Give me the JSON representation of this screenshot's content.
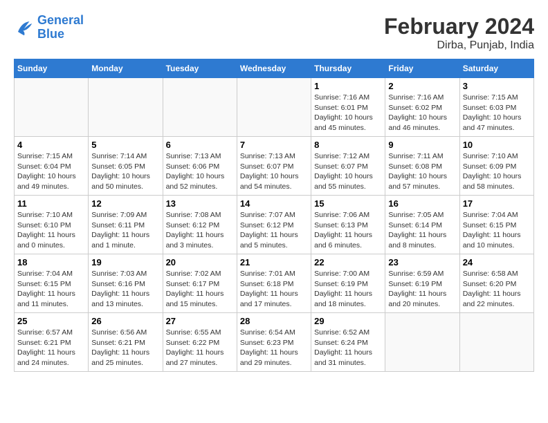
{
  "header": {
    "logo_line1": "General",
    "logo_line2": "Blue",
    "title": "February 2024",
    "subtitle": "Dirba, Punjab, India"
  },
  "days_of_week": [
    "Sunday",
    "Monday",
    "Tuesday",
    "Wednesday",
    "Thursday",
    "Friday",
    "Saturday"
  ],
  "weeks": [
    {
      "days": [
        {
          "number": "",
          "empty": true
        },
        {
          "number": "",
          "empty": true
        },
        {
          "number": "",
          "empty": true
        },
        {
          "number": "",
          "empty": true
        },
        {
          "number": "1",
          "sunrise": "7:16 AM",
          "sunset": "6:01 PM",
          "daylight": "10 hours and 45 minutes."
        },
        {
          "number": "2",
          "sunrise": "7:16 AM",
          "sunset": "6:02 PM",
          "daylight": "10 hours and 46 minutes."
        },
        {
          "number": "3",
          "sunrise": "7:15 AM",
          "sunset": "6:03 PM",
          "daylight": "10 hours and 47 minutes."
        }
      ]
    },
    {
      "days": [
        {
          "number": "4",
          "sunrise": "7:15 AM",
          "sunset": "6:04 PM",
          "daylight": "10 hours and 49 minutes."
        },
        {
          "number": "5",
          "sunrise": "7:14 AM",
          "sunset": "6:05 PM",
          "daylight": "10 hours and 50 minutes."
        },
        {
          "number": "6",
          "sunrise": "7:13 AM",
          "sunset": "6:06 PM",
          "daylight": "10 hours and 52 minutes."
        },
        {
          "number": "7",
          "sunrise": "7:13 AM",
          "sunset": "6:07 PM",
          "daylight": "10 hours and 54 minutes."
        },
        {
          "number": "8",
          "sunrise": "7:12 AM",
          "sunset": "6:07 PM",
          "daylight": "10 hours and 55 minutes."
        },
        {
          "number": "9",
          "sunrise": "7:11 AM",
          "sunset": "6:08 PM",
          "daylight": "10 hours and 57 minutes."
        },
        {
          "number": "10",
          "sunrise": "7:10 AM",
          "sunset": "6:09 PM",
          "daylight": "10 hours and 58 minutes."
        }
      ]
    },
    {
      "days": [
        {
          "number": "11",
          "sunrise": "7:10 AM",
          "sunset": "6:10 PM",
          "daylight": "11 hours and 0 minutes."
        },
        {
          "number": "12",
          "sunrise": "7:09 AM",
          "sunset": "6:11 PM",
          "daylight": "11 hours and 1 minute."
        },
        {
          "number": "13",
          "sunrise": "7:08 AM",
          "sunset": "6:12 PM",
          "daylight": "11 hours and 3 minutes."
        },
        {
          "number": "14",
          "sunrise": "7:07 AM",
          "sunset": "6:12 PM",
          "daylight": "11 hours and 5 minutes."
        },
        {
          "number": "15",
          "sunrise": "7:06 AM",
          "sunset": "6:13 PM",
          "daylight": "11 hours and 6 minutes."
        },
        {
          "number": "16",
          "sunrise": "7:05 AM",
          "sunset": "6:14 PM",
          "daylight": "11 hours and 8 minutes."
        },
        {
          "number": "17",
          "sunrise": "7:04 AM",
          "sunset": "6:15 PM",
          "daylight": "11 hours and 10 minutes."
        }
      ]
    },
    {
      "days": [
        {
          "number": "18",
          "sunrise": "7:04 AM",
          "sunset": "6:15 PM",
          "daylight": "11 hours and 11 minutes."
        },
        {
          "number": "19",
          "sunrise": "7:03 AM",
          "sunset": "6:16 PM",
          "daylight": "11 hours and 13 minutes."
        },
        {
          "number": "20",
          "sunrise": "7:02 AM",
          "sunset": "6:17 PM",
          "daylight": "11 hours and 15 minutes."
        },
        {
          "number": "21",
          "sunrise": "7:01 AM",
          "sunset": "6:18 PM",
          "daylight": "11 hours and 17 minutes."
        },
        {
          "number": "22",
          "sunrise": "7:00 AM",
          "sunset": "6:19 PM",
          "daylight": "11 hours and 18 minutes."
        },
        {
          "number": "23",
          "sunrise": "6:59 AM",
          "sunset": "6:19 PM",
          "daylight": "11 hours and 20 minutes."
        },
        {
          "number": "24",
          "sunrise": "6:58 AM",
          "sunset": "6:20 PM",
          "daylight": "11 hours and 22 minutes."
        }
      ]
    },
    {
      "days": [
        {
          "number": "25",
          "sunrise": "6:57 AM",
          "sunset": "6:21 PM",
          "daylight": "11 hours and 24 minutes."
        },
        {
          "number": "26",
          "sunrise": "6:56 AM",
          "sunset": "6:21 PM",
          "daylight": "11 hours and 25 minutes."
        },
        {
          "number": "27",
          "sunrise": "6:55 AM",
          "sunset": "6:22 PM",
          "daylight": "11 hours and 27 minutes."
        },
        {
          "number": "28",
          "sunrise": "6:54 AM",
          "sunset": "6:23 PM",
          "daylight": "11 hours and 29 minutes."
        },
        {
          "number": "29",
          "sunrise": "6:52 AM",
          "sunset": "6:24 PM",
          "daylight": "11 hours and 31 minutes."
        },
        {
          "number": "",
          "empty": true
        },
        {
          "number": "",
          "empty": true
        }
      ]
    }
  ]
}
